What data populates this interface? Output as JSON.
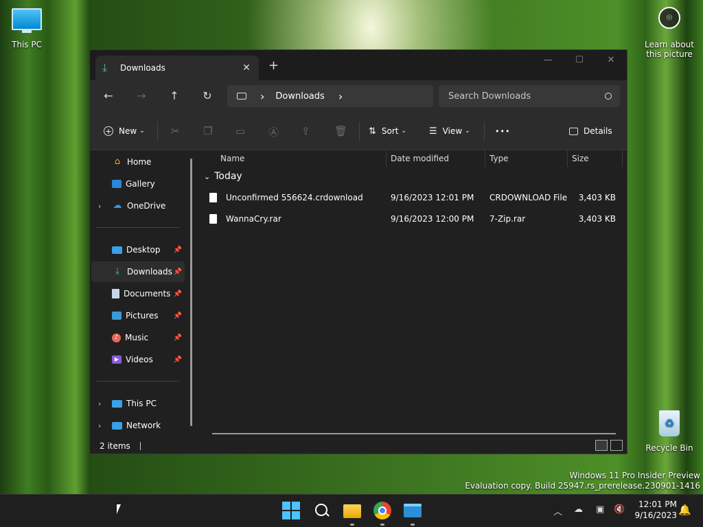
{
  "desktop": {
    "this_pc_label": "This PC",
    "learn_label": "Learn about this picture",
    "recycle_label": "Recycle Bin",
    "watermark_line1": "Windows 11 Pro Insider Preview",
    "watermark_line2": "Evaluation copy. Build 25947.rs_prerelease.230901-1416"
  },
  "tab": {
    "title": "Downloads",
    "close": "✕",
    "new_tab": "+"
  },
  "window_controls": {
    "minimize": "—",
    "maximize": "☐",
    "close": "✕"
  },
  "nav": {
    "back": "←",
    "forward": "→",
    "up": "↑",
    "refresh": "↻"
  },
  "address": {
    "chevron": "›",
    "crumb": "Downloads"
  },
  "search": {
    "placeholder": "Search Downloads"
  },
  "commands": {
    "new_label": "New",
    "sort_label": "Sort",
    "view_label": "View",
    "more_label": "•••",
    "details_label": "Details"
  },
  "sidebar": {
    "home": "Home",
    "gallery": "Gallery",
    "onedrive": "OneDrive",
    "desktop": "Desktop",
    "downloads": "Downloads",
    "documents": "Documents",
    "pictures": "Pictures",
    "music": "Music",
    "videos": "Videos",
    "thispc": "This PC",
    "network": "Network"
  },
  "columns": {
    "name": "Name",
    "date": "Date modified",
    "type": "Type",
    "size": "Size"
  },
  "group": {
    "label": "Today"
  },
  "files": [
    {
      "name": "Unconfirmed 556624.crdownload",
      "date": "9/16/2023 12:01 PM",
      "type": "CRDOWNLOAD File",
      "size": "3,403 KB"
    },
    {
      "name": "WannaCry.rar",
      "date": "9/16/2023 12:00 PM",
      "type": "7-Zip.rar",
      "size": "3,403 KB"
    }
  ],
  "status": {
    "items": "2 items"
  },
  "clock": {
    "time": "12:01 PM",
    "date": "9/16/2023"
  },
  "colors": {
    "accent": "#4cc2a0",
    "window_bg": "#202020",
    "toolbar_bg": "#2c2c2c",
    "selected": "#2d2d2d"
  }
}
